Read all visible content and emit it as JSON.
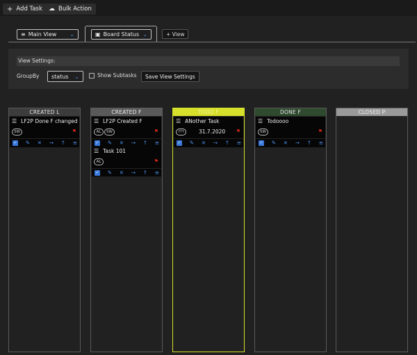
{
  "topbar": {
    "add_task": "Add Task",
    "bulk_action": "Bulk Action"
  },
  "views": {
    "main_view": "Main View",
    "board_status": "Board Status",
    "add_view": "+ View"
  },
  "settings": {
    "title": "View Settings:",
    "groupby_label": "GroupBy",
    "groupby_value": "status",
    "show_subtasks": "Show Subtasks",
    "show_subtasks_checked": false,
    "save_button": "Save View Settings"
  },
  "columns": [
    {
      "title": "CREATED L",
      "color": "#3c3c3c",
      "cards": [
        {
          "title": "LF2P Done F changed",
          "badges": [
            "SW"
          ],
          "flag": true,
          "date": ""
        }
      ]
    },
    {
      "title": "CREATED F",
      "color": "#5a5a5a",
      "cards": [
        {
          "title": "LF2P Created F",
          "badges": [
            "AL",
            "SW"
          ],
          "flag": true,
          "date": ""
        },
        {
          "title": "Task 101",
          "badges": [
            "AL"
          ],
          "flag": true,
          "date": ""
        }
      ]
    },
    {
      "title": "TODO F",
      "color": "#d7e02a",
      "cards": [
        {
          "title": "ANother Task",
          "badges": [
            "???"
          ],
          "flag": true,
          "date": "31.7.2020"
        }
      ]
    },
    {
      "title": "DONE F",
      "color": "#2f4a2f",
      "cards": [
        {
          "title": "Todoooo",
          "badges": [
            "SW"
          ],
          "flag": true,
          "date": ""
        }
      ]
    },
    {
      "title": "CLOSED P",
      "color": "#9a9a9a",
      "cards": []
    }
  ],
  "icons": {
    "add": "plus-icon",
    "bulk": "cloud-icon",
    "menu": "hamburger-icon",
    "view": "list-icon",
    "board": "board-icon",
    "chevron": "chevron-down-icon",
    "flag": "flag-icon",
    "check": "checkbox-icon",
    "edit": "pencil-icon",
    "delete": "close-icon",
    "move": "arrow-right-icon",
    "up": "arrow-up-icon"
  }
}
